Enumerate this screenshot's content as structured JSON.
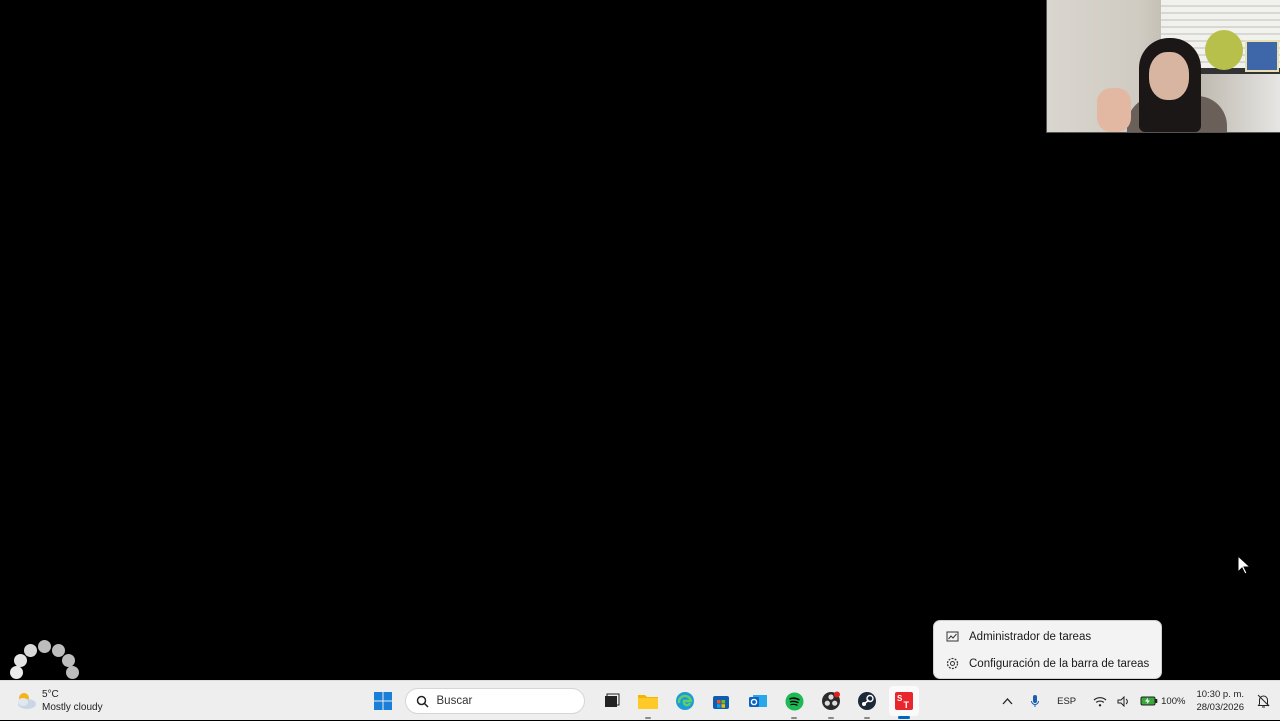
{
  "weather": {
    "temperature": "5°C",
    "condition": "Mostly cloudy"
  },
  "search": {
    "placeholder": "Buscar"
  },
  "taskbar_apps": [
    "start-icon",
    "task-view-icon",
    "file-explorer-icon",
    "edge-icon",
    "store-icon",
    "outlook-icon",
    "spotify-icon",
    "obs-icon",
    "steam-icon",
    "st-app-icon"
  ],
  "context_menu": {
    "items": [
      {
        "label": "Administrador de tareas",
        "icon": "task-manager-icon"
      },
      {
        "label": "Configuración de la barra de tareas",
        "icon": "gear-icon"
      }
    ]
  },
  "tray": {
    "language": "ESP",
    "battery": "100%",
    "time": "10:30 p. m.",
    "date": "28/03/2026"
  },
  "colors": {
    "accent": "#0067c0",
    "desktop": "#000000",
    "taskbar": "#eeeeef"
  }
}
